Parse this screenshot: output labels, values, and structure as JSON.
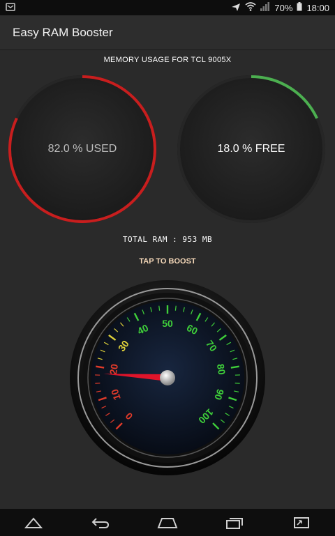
{
  "status_bar": {
    "battery": "70%",
    "time": "18:00"
  },
  "app": {
    "title": "Easy RAM Booster"
  },
  "memory": {
    "title": "MEMORY USAGE FOR TCL 9005X",
    "used_label": "82.0 % USED",
    "free_label": "18.0 % FREE",
    "used_fraction": 0.82,
    "free_fraction": 0.18,
    "total_ram": "TOTAL RAM : 953 MB"
  },
  "boost": {
    "label": "TAP TO BOOST"
  },
  "gauge": {
    "ticks": [
      "0",
      "10",
      "20",
      "30",
      "40",
      "50",
      "60",
      "70",
      "80",
      "90",
      "100"
    ],
    "needle_value": 18
  },
  "colors": {
    "used": "#c81e1e",
    "free": "#4caf50",
    "boost_text": "#f4d7b8"
  },
  "nav": {
    "icons": [
      "back-icon",
      "return-icon",
      "home-icon",
      "recents-icon",
      "screenshot-icon"
    ]
  }
}
